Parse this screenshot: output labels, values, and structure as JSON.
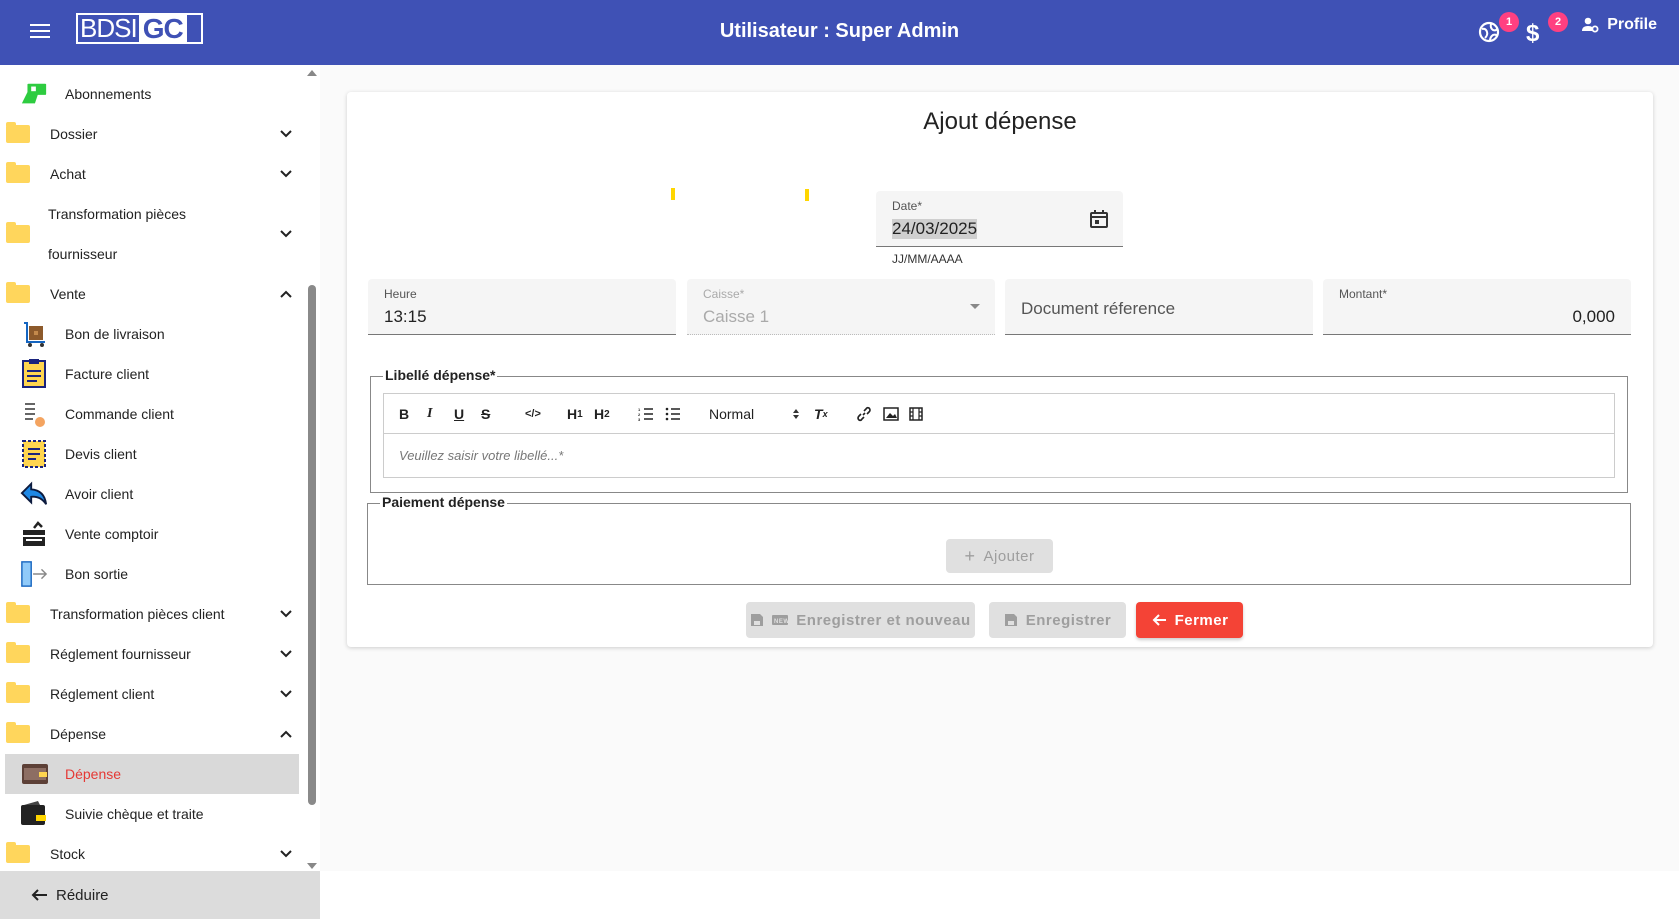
{
  "header": {
    "logo_left": "BDSI",
    "logo_right": "GC",
    "title": "Utilisateur : Super Admin",
    "notif_badge": "1",
    "money_badge": "2",
    "profile_label": "Profile"
  },
  "sidebar": {
    "items": [
      {
        "label": "Abonnements"
      },
      {
        "label": "Dossier"
      },
      {
        "label": "Achat"
      },
      {
        "label": "Transformation pièces"
      },
      {
        "label": "fournisseur"
      },
      {
        "label": "Vente"
      },
      {
        "label": "Bon de livraison"
      },
      {
        "label": "Facture client"
      },
      {
        "label": "Commande client"
      },
      {
        "label": "Devis client"
      },
      {
        "label": "Avoir client"
      },
      {
        "label": "Vente comptoir"
      },
      {
        "label": "Bon sortie"
      },
      {
        "label": "Transformation pièces client"
      },
      {
        "label": "Réglement fournisseur"
      },
      {
        "label": "Réglement client"
      },
      {
        "label": "Dépense"
      },
      {
        "label": "Dépense"
      },
      {
        "label": "Suivie chèque et traite"
      },
      {
        "label": "Stock"
      }
    ],
    "reduce_label": "Réduire"
  },
  "form": {
    "title": "Ajout dépense",
    "date": {
      "label": "Date*",
      "value": "24/03/2025",
      "hint": "JJ/MM/AAAA"
    },
    "heure": {
      "label": "Heure",
      "value": "13:15"
    },
    "caisse": {
      "label": "Caisse*",
      "value": "Caisse 1"
    },
    "document": {
      "placeholder": "Document réference"
    },
    "montant": {
      "label": "Montant*",
      "value": "0,000"
    },
    "libelle": {
      "legend": "Libellé dépense*",
      "header_select": "Normal",
      "placeholder": "Veuillez saisir votre libellé...*"
    },
    "paiement": {
      "legend": "Paiement dépense",
      "add_label": "Ajouter"
    },
    "buttons": {
      "save_new": "Enregistrer et nouveau",
      "save": "Enregistrer",
      "close": "Fermer"
    }
  },
  "colors": {
    "header": "#3f51b5",
    "danger": "#f44336",
    "badge": "#ff4081",
    "active_text": "#e53935"
  }
}
